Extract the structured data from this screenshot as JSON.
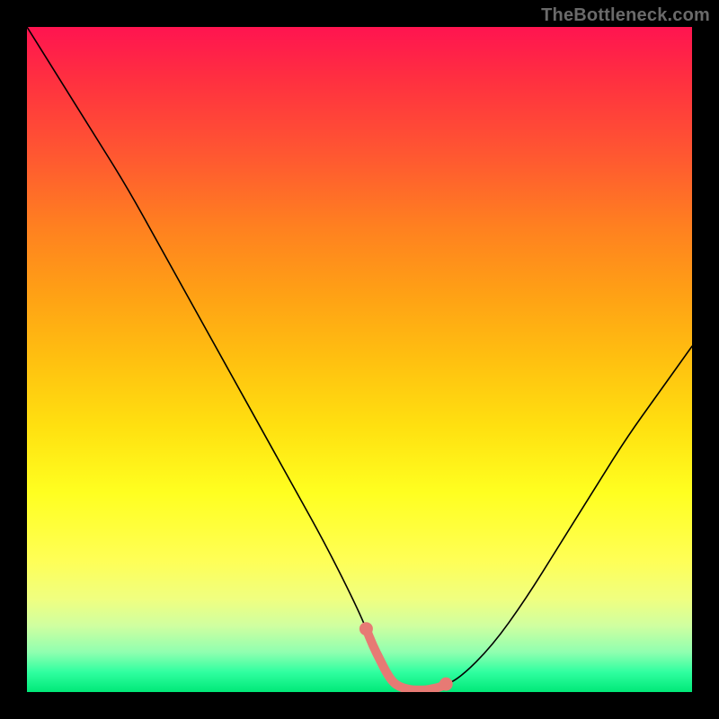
{
  "watermark": "TheBottleneck.com",
  "colors": {
    "background": "#000000",
    "curve": "#000000",
    "highlight": "#e77a74",
    "gradient_top": "#ff1450",
    "gradient_bottom": "#00e878"
  },
  "chart_data": {
    "type": "line",
    "title": "",
    "xlabel": "",
    "ylabel": "",
    "xlim": [
      0,
      100
    ],
    "ylim": [
      0,
      100
    ],
    "grid": false,
    "legend": false,
    "series": [
      {
        "name": "curve",
        "x": [
          0,
          5,
          10,
          15,
          20,
          25,
          30,
          35,
          40,
          45,
          50,
          52,
          54,
          56,
          58,
          60,
          62,
          65,
          70,
          75,
          80,
          85,
          90,
          95,
          100
        ],
        "values": [
          100,
          92,
          84,
          76,
          67,
          58,
          49,
          40,
          31,
          22,
          12,
          7,
          3,
          0.8,
          0.3,
          0.3,
          0.7,
          2,
          7,
          14,
          22,
          30,
          38,
          45,
          52
        ]
      },
      {
        "name": "highlight_band",
        "x": [
          51,
          52,
          53,
          54,
          55,
          56,
          57,
          58,
          59,
          60,
          61,
          62,
          63
        ],
        "values": [
          9.5,
          7,
          5,
          3,
          1.5,
          0.8,
          0.5,
          0.3,
          0.3,
          0.3,
          0.5,
          0.7,
          1.2
        ]
      }
    ]
  }
}
